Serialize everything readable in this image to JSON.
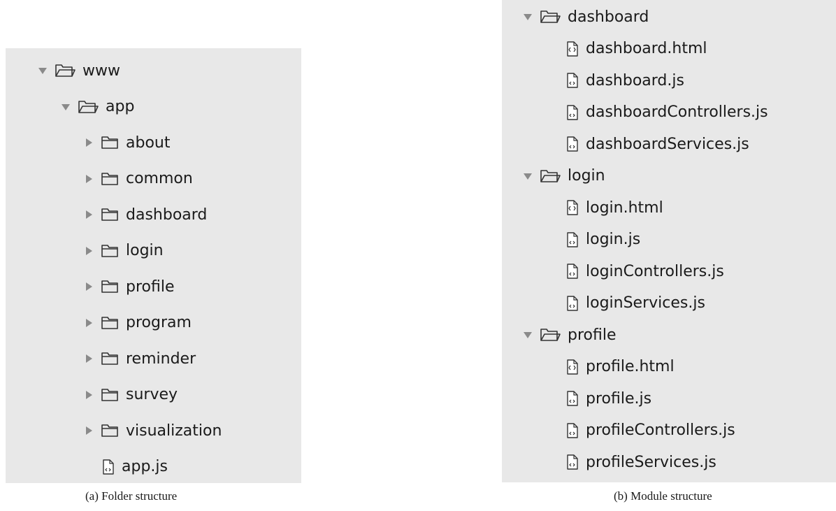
{
  "panel_a": {
    "tree": [
      {
        "label": "www",
        "kind": "folder",
        "expanded": true,
        "depth": 0
      },
      {
        "label": "app",
        "kind": "folder",
        "expanded": true,
        "depth": 1
      },
      {
        "label": "about",
        "kind": "folder",
        "expanded": false,
        "depth": 2
      },
      {
        "label": "common",
        "kind": "folder",
        "expanded": false,
        "depth": 2
      },
      {
        "label": "dashboard",
        "kind": "folder",
        "expanded": false,
        "depth": 2
      },
      {
        "label": "login",
        "kind": "folder",
        "expanded": false,
        "depth": 2
      },
      {
        "label": "profile",
        "kind": "folder",
        "expanded": false,
        "depth": 2
      },
      {
        "label": "program",
        "kind": "folder",
        "expanded": false,
        "depth": 2
      },
      {
        "label": "reminder",
        "kind": "folder",
        "expanded": false,
        "depth": 2
      },
      {
        "label": "survey",
        "kind": "folder",
        "expanded": false,
        "depth": 2
      },
      {
        "label": "visualization",
        "kind": "folder",
        "expanded": false,
        "depth": 2
      },
      {
        "label": "app.js",
        "kind": "js-file",
        "depth": 2
      }
    ],
    "caption": "(a)  Folder structure"
  },
  "panel_b": {
    "tree": [
      {
        "label": "dashboard",
        "kind": "folder",
        "expanded": true,
        "depth": 0
      },
      {
        "label": "dashboard.html",
        "kind": "html-file",
        "depth": 1
      },
      {
        "label": "dashboard.js",
        "kind": "js-file",
        "depth": 1
      },
      {
        "label": "dashboardControllers.js",
        "kind": "js-file",
        "depth": 1
      },
      {
        "label": "dashboardServices.js",
        "kind": "js-file",
        "depth": 1
      },
      {
        "label": "login",
        "kind": "folder",
        "expanded": true,
        "depth": 0
      },
      {
        "label": "login.html",
        "kind": "html-file",
        "depth": 1
      },
      {
        "label": "login.js",
        "kind": "js-file",
        "depth": 1
      },
      {
        "label": "loginControllers.js",
        "kind": "js-file",
        "depth": 1
      },
      {
        "label": "loginServices.js",
        "kind": "js-file",
        "depth": 1
      },
      {
        "label": "profile",
        "kind": "folder",
        "expanded": true,
        "depth": 0
      },
      {
        "label": "profile.html",
        "kind": "html-file",
        "depth": 1
      },
      {
        "label": "profile.js",
        "kind": "js-file",
        "depth": 1
      },
      {
        "label": "profileControllers.js",
        "kind": "js-file",
        "depth": 1
      },
      {
        "label": "profileServices.js",
        "kind": "js-file",
        "depth": 1
      }
    ],
    "caption": "(b)  Module structure"
  },
  "colors": {
    "panel_bg": "#e8e8e8",
    "triangle": "#8a8a8a",
    "icon_stroke": "#333333",
    "text": "#1a1a1a"
  }
}
